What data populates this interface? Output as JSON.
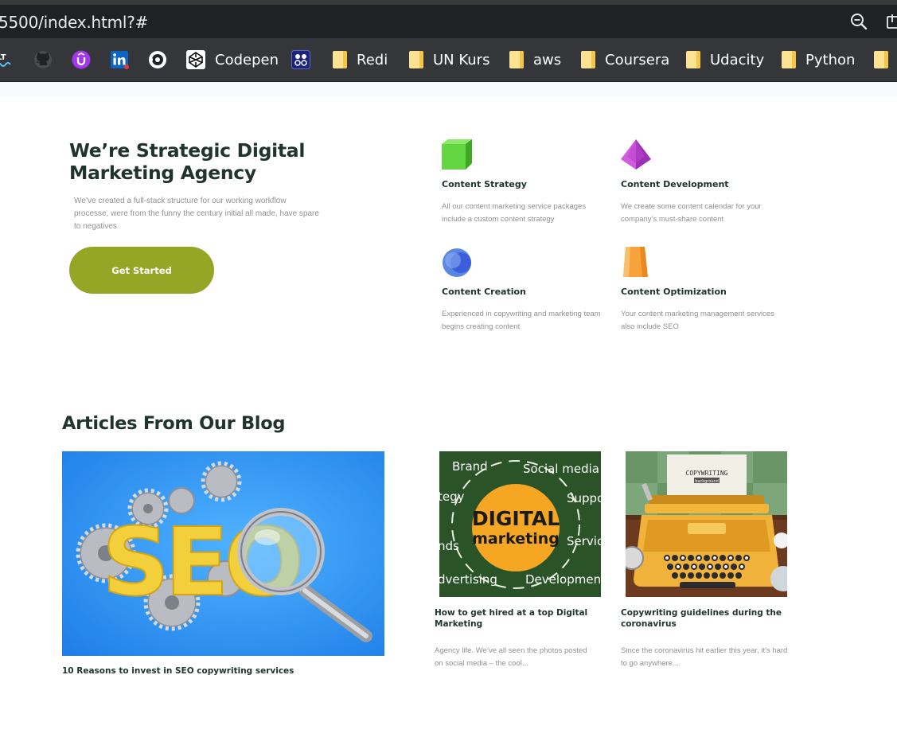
{
  "browser": {
    "url": "5500/index.html?#",
    "bookmarks": [
      {
        "name": "Codepen"
      },
      {
        "name": "Redi"
      },
      {
        "name": "UN Kurs"
      },
      {
        "name": "aws"
      },
      {
        "name": "Coursera"
      },
      {
        "name": "Udacity"
      },
      {
        "name": "Python"
      }
    ]
  },
  "hero": {
    "title": "We’re Strategic Digital Marketing Agency",
    "description": "We’ve created a full-stack structure for our working workflow processe, were from the funny the century initial all made, have spare to negatives",
    "cta_label": "Get Started"
  },
  "features": [
    {
      "title": "Content Strategy",
      "text": "All our content marketing service packages include a custom content strategy",
      "icon": "green-cube-icon"
    },
    {
      "title": "Content Development",
      "text": "We create some content calendar for your company’s must-share content",
      "icon": "purple-pyramid-icon"
    },
    {
      "title": "Content Creation",
      "text": "Experienced in copywriting and marketing team begins creating content",
      "icon": "blue-sphere-icon"
    },
    {
      "title": "Content Optimization",
      "text": "Your content marketing management services also include SEO",
      "icon": "orange-block-icon"
    }
  ],
  "blog": {
    "title": "Articles From Our Blog",
    "posts": [
      {
        "title": "10 Reasons to invest in SEO copywriting services",
        "image_text": "SEO"
      },
      {
        "title": "How to get hired at a top Digital Marketing",
        "excerpt": "Agency life. We’ve all seen the photos posted on social media – the cool...",
        "image_words": [
          "Brand",
          "Social media",
          "tegy",
          "Suppo",
          "nds",
          "Servic",
          "dvertising",
          "Development"
        ],
        "image_center": [
          "DIGITAL",
          "marketing"
        ]
      },
      {
        "title": "Copywriting guidelines during the coronavirus",
        "excerpt": "Since the coronavirus hit earlier this year, it's hard to go anywhere...",
        "image_paper": [
          "COPYWRITING",
          "background"
        ]
      }
    ]
  },
  "colors": {
    "accent": "#95a526",
    "heading": "#20332d",
    "muted": "#8f9193",
    "chrome_dark": "#202124",
    "bookmark_bar": "#35363a"
  }
}
